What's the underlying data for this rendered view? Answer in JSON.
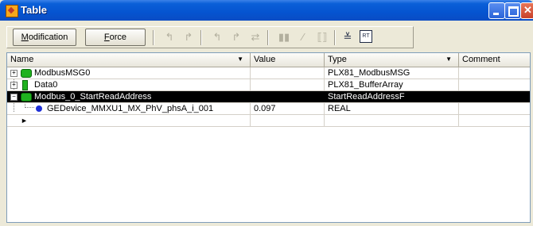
{
  "window": {
    "title": "Table"
  },
  "toolbar": {
    "modification_label_pre": "",
    "modification_label_u": "M",
    "modification_label_post": "odification",
    "force_label_u": "F",
    "force_label_post": "orce"
  },
  "columns": {
    "name": "Name",
    "value": "Value",
    "type": "Type",
    "comment": "Comment"
  },
  "rows": [
    {
      "name": "ModbusMSG0",
      "value": "",
      "type": "PLX81_ModbusMSG",
      "comment": ""
    },
    {
      "name": "Data0",
      "value": "",
      "type": "PLX81_BufferArray",
      "comment": ""
    },
    {
      "name": "Modbus_0_StartReadAddress",
      "value": "",
      "type": "StartReadAddressF",
      "comment": ""
    },
    {
      "name": "GEDevice_MMXU1_MX_PhV_phsA_i_001",
      "value": "0.097",
      "type": "REAL",
      "comment": ""
    }
  ],
  "icons": {
    "app": "table-app-icon",
    "expand": "plus-icon",
    "collapse": "minus-icon",
    "variable": "green-variable-icon",
    "array": "green-array-icon",
    "element": "blue-dot-icon",
    "new_row": "arrow-right-icon"
  },
  "colors": {
    "titlebar": "#0554d0",
    "selection": "#000000",
    "variable_icon": "#1fb21f",
    "element_icon": "#1e2fd6"
  }
}
